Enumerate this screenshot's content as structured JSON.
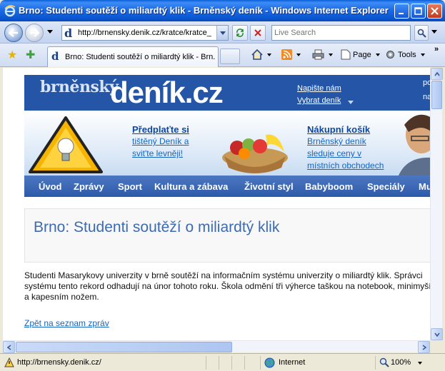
{
  "window": {
    "title": "Brno: Studenti soutěží o miliardtý klik - Brněnský deník - Windows Internet Explorer"
  },
  "address_bar": {
    "url": "http://brnensky.denik.cz/kratce/kratce_",
    "search_placeholder": "Live Search"
  },
  "tab": {
    "label": "Brno: Studenti soutěží o miliardtý klik - Brn..."
  },
  "commands": {
    "page_label": "Page",
    "tools_label": "Tools"
  },
  "site": {
    "logo_small": "brněnský",
    "logo_big": "deník.cz",
    "top_links": [
      "Napište nám",
      "Vybrat deník"
    ],
    "top_right": [
      "po",
      "na"
    ],
    "promo_left": {
      "title": "Předplaťte si",
      "lines": [
        "tištěný Deník a",
        "svit'te levněji!"
      ]
    },
    "promo_right": {
      "title": "Nákupní košík",
      "lines": [
        "Brněnský deník",
        "sleduje ceny v",
        "místních obchodech"
      ]
    },
    "nav_items": [
      "Úvod",
      "Zprávy",
      "Sport",
      "Kultura a zábava",
      "Životní styl",
      "Babyboom",
      "Speciály",
      "Mu"
    ]
  },
  "article": {
    "headline": "Brno: Studenti soutěží o miliardtý klik",
    "body": "Studenti Masarykovy univerzity v brně soutěží na informačním systému univerzity o miliardtý klik. Správci systému tento rekord odhadují na únor tohoto roku. Škola odmění tři výherce taškou na notebook, minimyší a kapesním nožem.",
    "back_link": "Zpět na seznam zpráv"
  },
  "status_bar": {
    "url": "http://brnensky.denik.cz/",
    "zone": "Internet",
    "zoom": "100%"
  },
  "colors": {
    "titlebar": "#0a56d0",
    "site_banner": "#2455a7",
    "headline": "#3d6bb3",
    "link": "#1565c0"
  }
}
